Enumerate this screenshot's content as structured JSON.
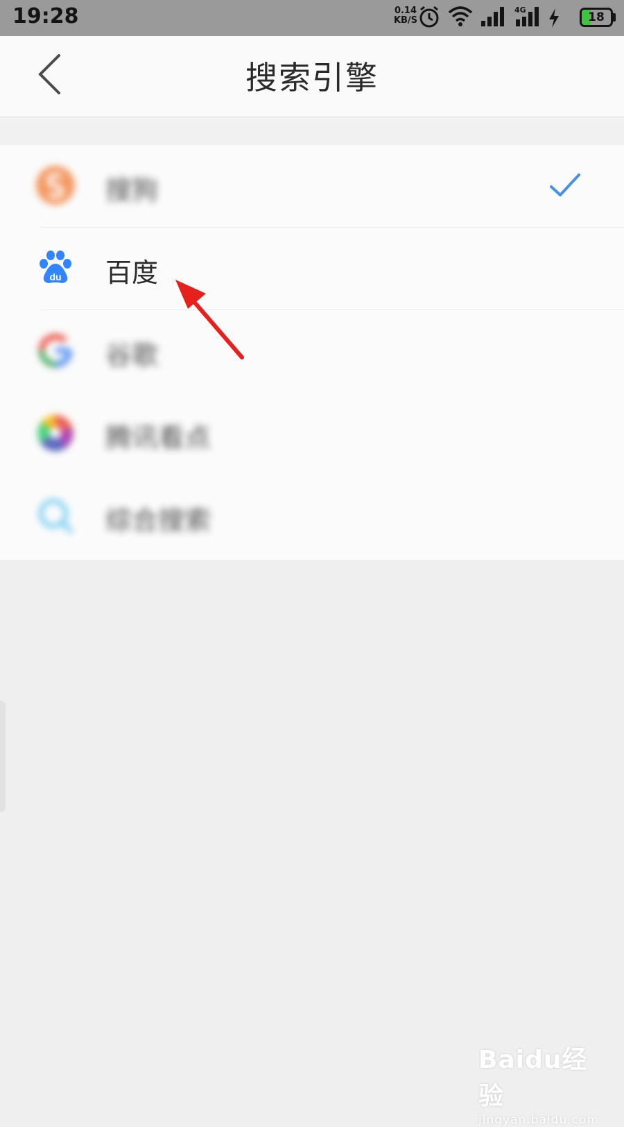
{
  "status_bar": {
    "time": "19:28",
    "speed_value": "0.14",
    "speed_unit": "KB/S",
    "network": "4G",
    "battery": "18"
  },
  "header": {
    "title": "搜索引擎"
  },
  "engines": [
    {
      "label": "搜狗",
      "icon": "sogou-icon",
      "selected": true
    },
    {
      "label": "百度",
      "icon": "baidu-paw-icon",
      "selected": false
    },
    {
      "label": "谷歌",
      "icon": "google-icon",
      "selected": false
    },
    {
      "label": "腾讯看点",
      "icon": "tencent-icon",
      "selected": false
    },
    {
      "label": "综合搜索",
      "icon": "search-icon",
      "selected": false
    }
  ],
  "colors": {
    "check": "#4a90e2",
    "arrow": "#e5201d",
    "sogou": "#f2894a",
    "baidu": "#3385ff"
  },
  "watermark": {
    "brand": "Baidu经验",
    "url": "jingyan.baidu.com"
  }
}
